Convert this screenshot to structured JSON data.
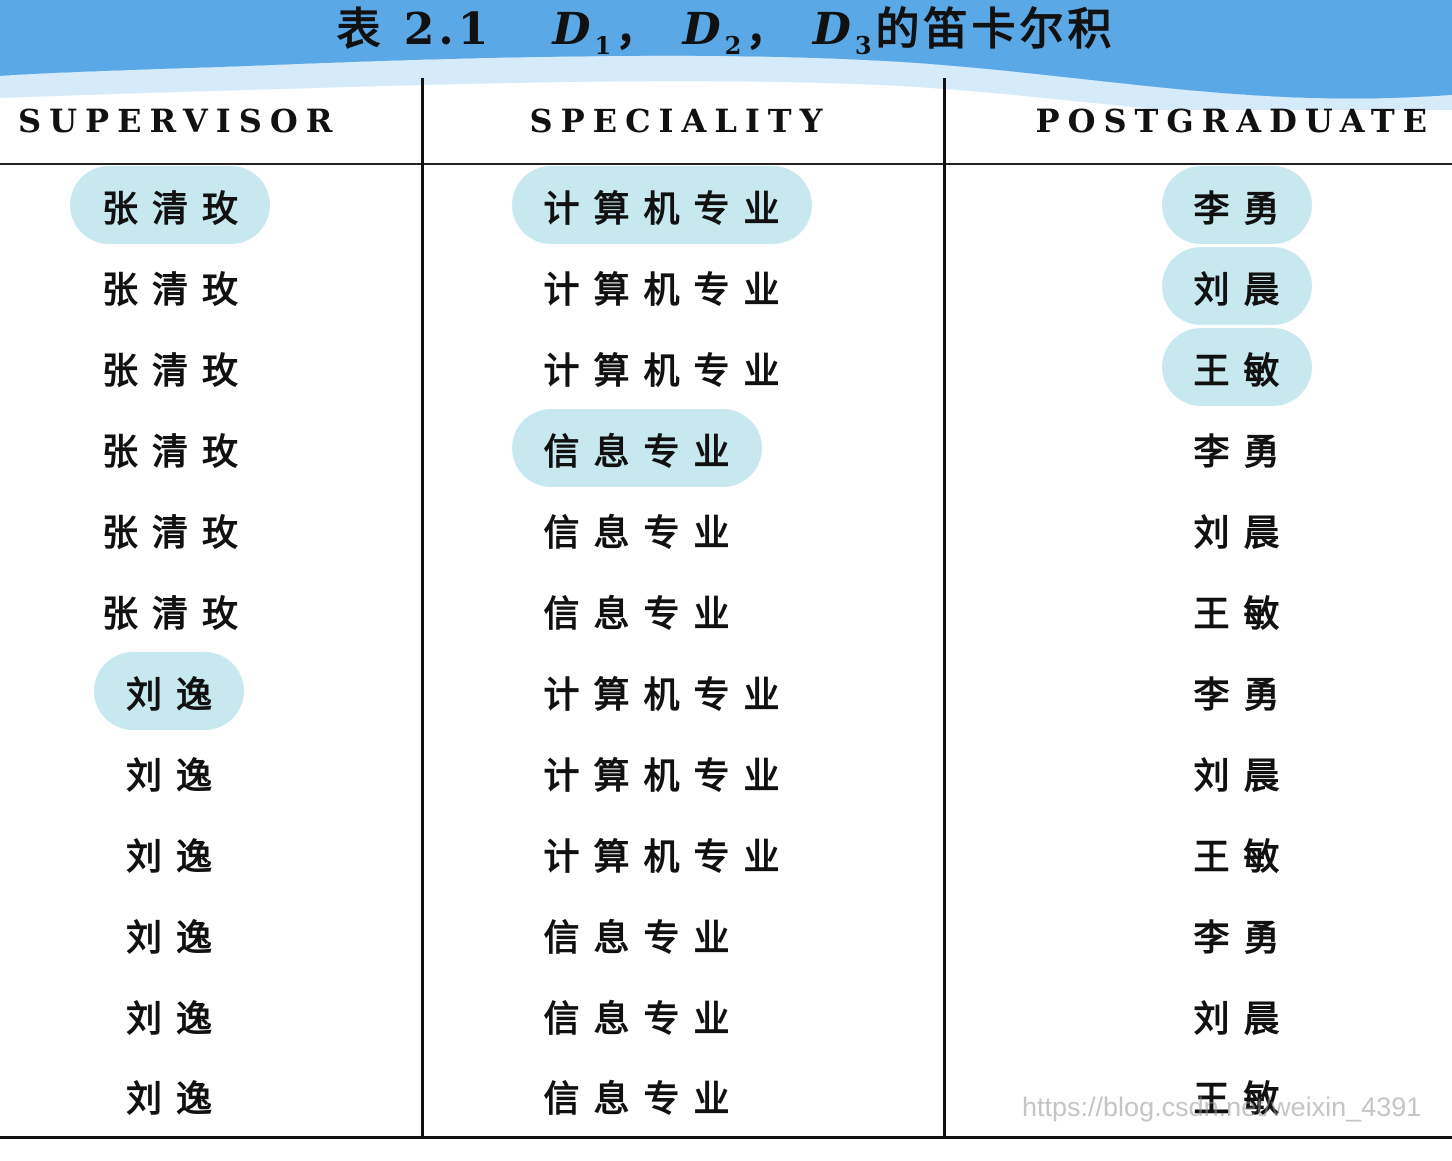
{
  "title": {
    "label": "表 2.1",
    "d": "D",
    "s1": "1",
    "s2": "2",
    "s3": "3",
    "comma": "，",
    "suffix": "的笛卡尔积"
  },
  "headers": [
    "SUPERVISOR",
    "SPECIALITY",
    "POSTGRADUATE"
  ],
  "rows": [
    [
      "张清玫",
      "计算机专业",
      "李勇"
    ],
    [
      "张清玫",
      "计算机专业",
      "刘晨"
    ],
    [
      "张清玫",
      "计算机专业",
      "王敏"
    ],
    [
      "张清玫",
      "信息专业",
      "李勇"
    ],
    [
      "张清玫",
      "信息专业",
      "刘晨"
    ],
    [
      "张清玫",
      "信息专业",
      "王敏"
    ],
    [
      "刘逸",
      "计算机专业",
      "李勇"
    ],
    [
      "刘逸",
      "计算机专业",
      "刘晨"
    ],
    [
      "刘逸",
      "计算机专业",
      "王敏"
    ],
    [
      "刘逸",
      "信息专业",
      "李勇"
    ],
    [
      "刘逸",
      "信息专业",
      "刘晨"
    ],
    [
      "刘逸",
      "信息专业",
      "王敏"
    ]
  ],
  "watermark": "https://blog.csdn.net/weixin_4391",
  "colors": {
    "banner": "#5ba8e6",
    "highlight": "#c8e8f0"
  }
}
